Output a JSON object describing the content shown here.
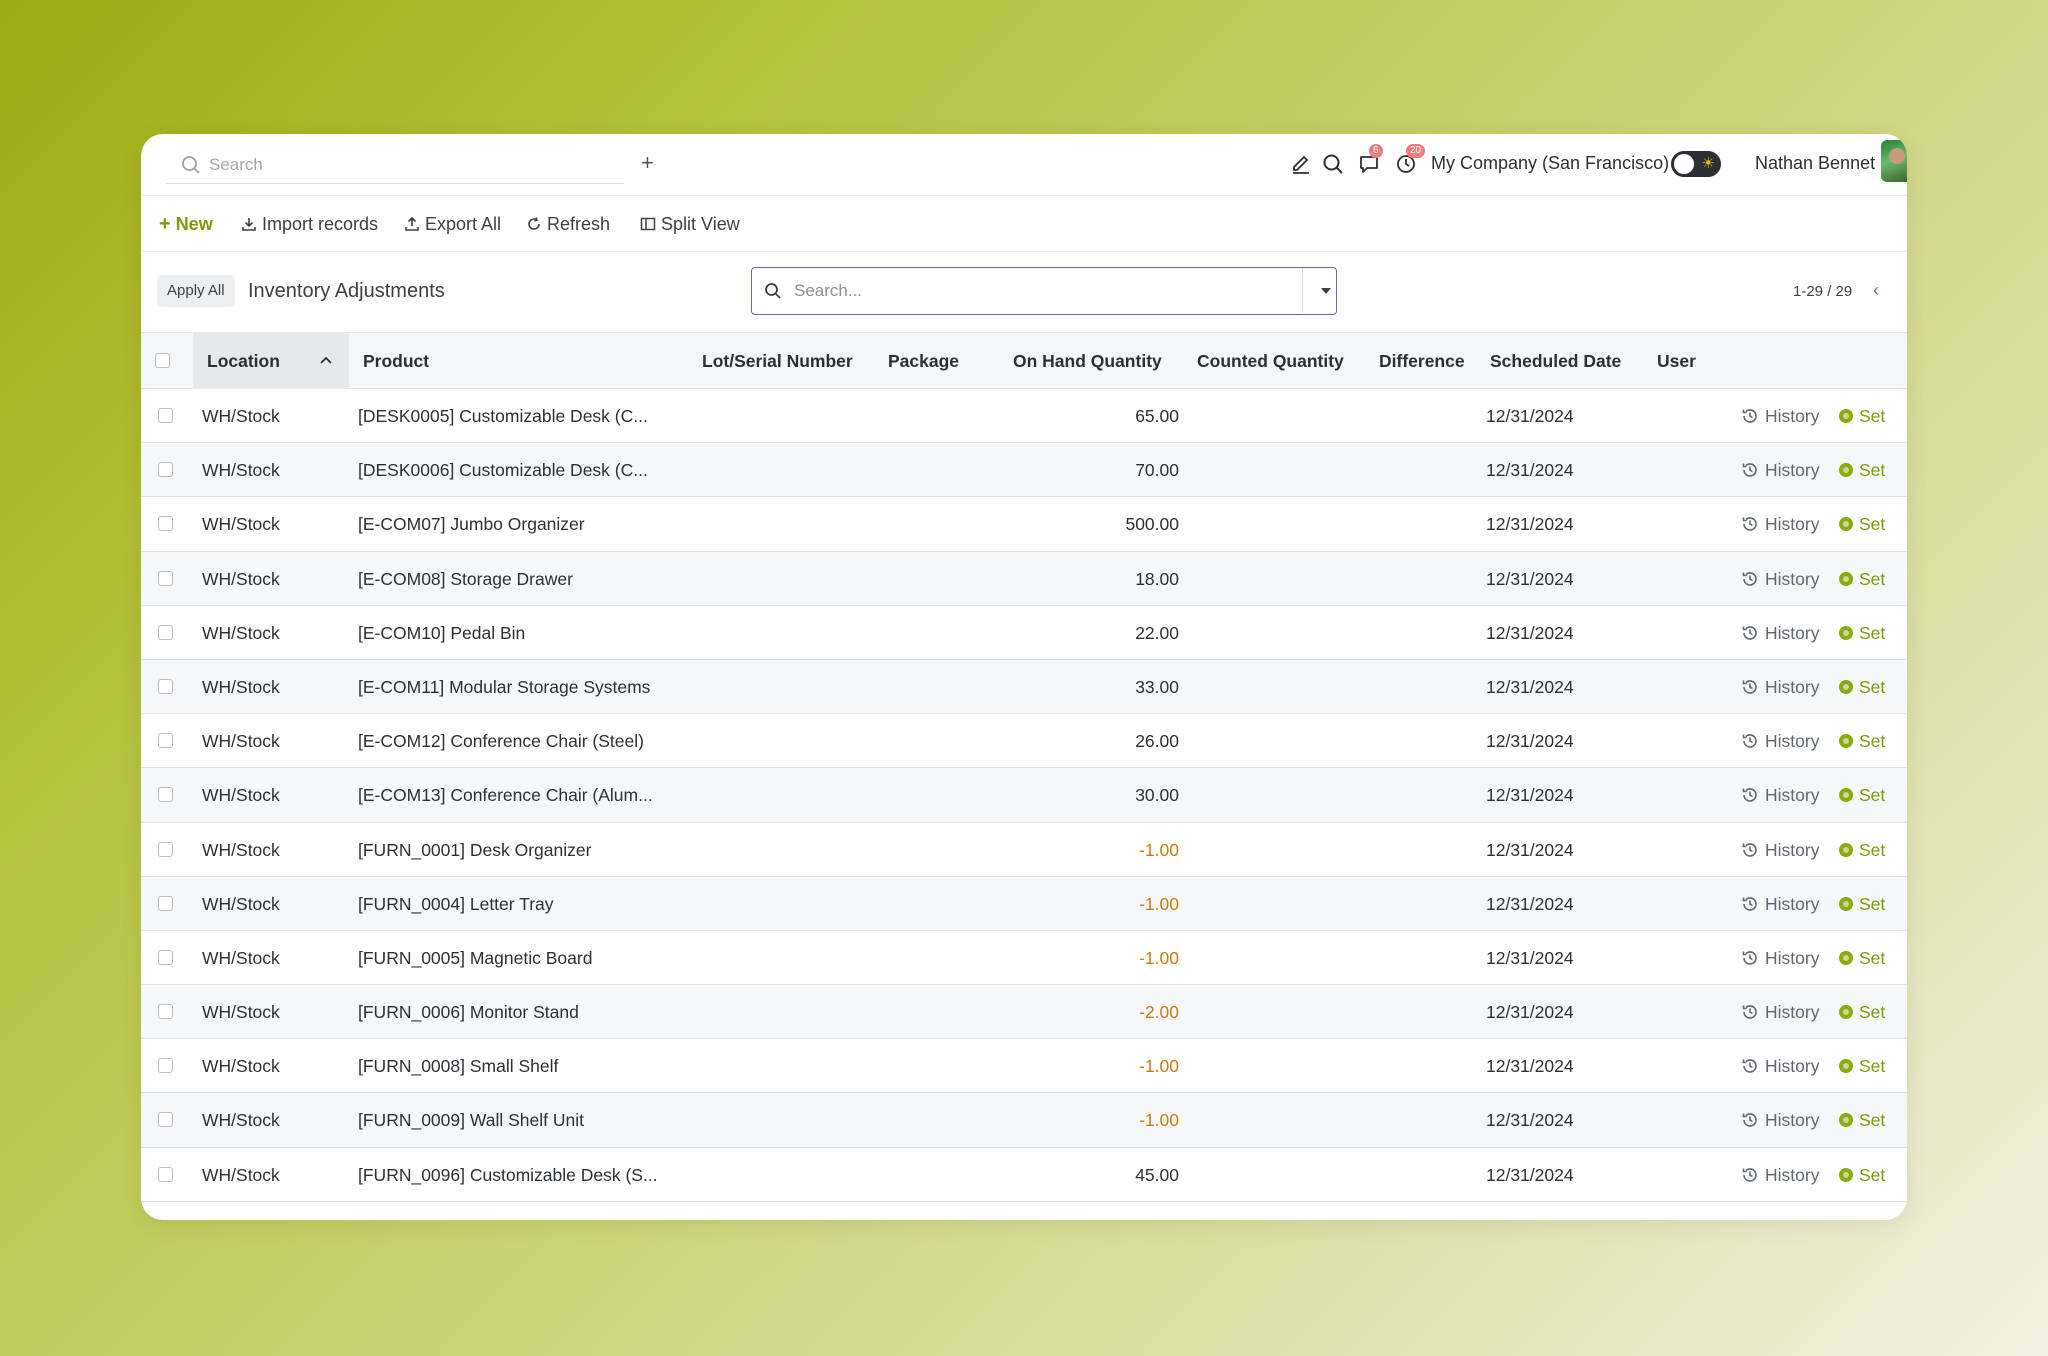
{
  "topbar": {
    "search_placeholder": "Search",
    "plus_label": "+",
    "messages_count": "6",
    "activities_count": "20",
    "company": "My Company (San Francisco)",
    "user_name": "Nathan Bennet"
  },
  "actions": {
    "new_label": "New",
    "import_label": "Import records",
    "export_label": "Export All",
    "refresh_label": "Refresh",
    "split_label": "Split View"
  },
  "controls": {
    "apply_all_label": "Apply All",
    "page_title": "Inventory Adjustments",
    "search_placeholder": "Search...",
    "pager": "1-29 / 29"
  },
  "columns": {
    "location": "Location",
    "product": "Product",
    "lot": "Lot/Serial Number",
    "package": "Package",
    "on_hand": "On Hand Quantity",
    "counted": "Counted Quantity",
    "difference": "Difference",
    "scheduled": "Scheduled Date",
    "user": "User"
  },
  "row_actions": {
    "history_label": "History",
    "set_label": "Set"
  },
  "colors": {
    "accent": "#7a9a0a",
    "negative": "#c47d10",
    "focus": "#7b5fa5"
  },
  "rows": [
    {
      "location": "WH/Stock",
      "product": "[DESK0005] Customizable Desk (C...",
      "on_hand": "65.00",
      "date": "12/31/2024",
      "negative": false
    },
    {
      "location": "WH/Stock",
      "product": "[DESK0006] Customizable Desk (C...",
      "on_hand": "70.00",
      "date": "12/31/2024",
      "negative": false
    },
    {
      "location": "WH/Stock",
      "product": "[E-COM07] Jumbo Organizer",
      "on_hand": "500.00",
      "date": "12/31/2024",
      "negative": false
    },
    {
      "location": "WH/Stock",
      "product": "[E-COM08] Storage Drawer",
      "on_hand": "18.00",
      "date": "12/31/2024",
      "negative": false
    },
    {
      "location": "WH/Stock",
      "product": "[E-COM10] Pedal Bin",
      "on_hand": "22.00",
      "date": "12/31/2024",
      "negative": false
    },
    {
      "location": "WH/Stock",
      "product": "[E-COM11] Modular Storage Systems",
      "on_hand": "33.00",
      "date": "12/31/2024",
      "negative": false
    },
    {
      "location": "WH/Stock",
      "product": "[E-COM12] Conference Chair (Steel)",
      "on_hand": "26.00",
      "date": "12/31/2024",
      "negative": false
    },
    {
      "location": "WH/Stock",
      "product": "[E-COM13] Conference Chair (Alum...",
      "on_hand": "30.00",
      "date": "12/31/2024",
      "negative": false
    },
    {
      "location": "WH/Stock",
      "product": "[FURN_0001] Desk Organizer",
      "on_hand": "-1.00",
      "date": "12/31/2024",
      "negative": true
    },
    {
      "location": "WH/Stock",
      "product": "[FURN_0004] Letter Tray",
      "on_hand": "-1.00",
      "date": "12/31/2024",
      "negative": true
    },
    {
      "location": "WH/Stock",
      "product": "[FURN_0005] Magnetic Board",
      "on_hand": "-1.00",
      "date": "12/31/2024",
      "negative": true
    },
    {
      "location": "WH/Stock",
      "product": "[FURN_0006] Monitor Stand",
      "on_hand": "-2.00",
      "date": "12/31/2024",
      "negative": true
    },
    {
      "location": "WH/Stock",
      "product": "[FURN_0008] Small Shelf",
      "on_hand": "-1.00",
      "date": "12/31/2024",
      "negative": true
    },
    {
      "location": "WH/Stock",
      "product": "[FURN_0009] Wall Shelf Unit",
      "on_hand": "-1.00",
      "date": "12/31/2024",
      "negative": true
    },
    {
      "location": "WH/Stock",
      "product": "[FURN_0096] Customizable Desk (S...",
      "on_hand": "45.00",
      "date": "12/31/2024",
      "negative": false
    }
  ]
}
